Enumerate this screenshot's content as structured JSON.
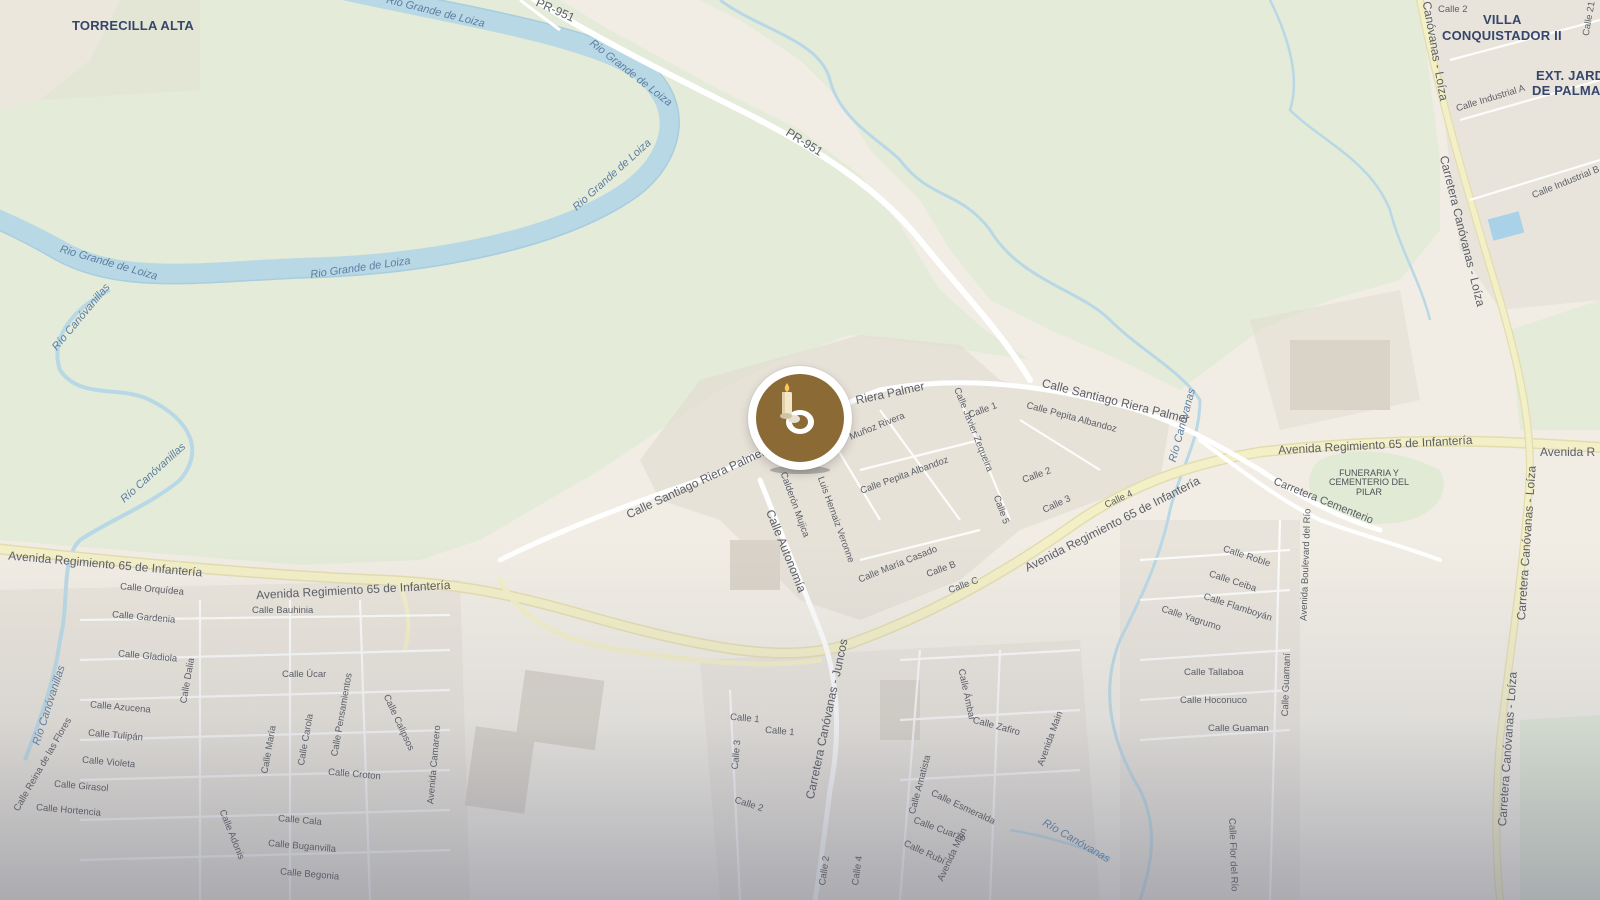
{
  "map": {
    "places": {
      "torrecilla_alta": "TORRECILLA ALTA",
      "villa_conquistador_1": "VILLA",
      "villa_conquistador_2": "CONQUISTADOR II",
      "ext_jard_1": "EXT. JARD",
      "ext_jard_2": "DE PALMA"
    },
    "rivers": {
      "rio_grande_1": "Rio Grande de Loiza",
      "rio_grande_2": "Rio Grande de Loiza",
      "rio_grande_3": "Rio Grande de Loiza",
      "rio_grande_4": "Rio Grande de Loiza",
      "rio_grande_5": "Rio Grande de Loiza",
      "rio_grande_6": "Rio Grande de Loiza",
      "rio_canovanillas_1": "Río Canóvanillas",
      "rio_canovanillas_2": "Río Canóvanillas",
      "rio_canovanillas_3": "Río Canóvanillas",
      "rio_canovanas_1": "Río Canóvanas",
      "rio_canovanas_2": "Río Canóvanas"
    },
    "roads": {
      "pr951_top": "PR-951",
      "pr951": "PR-951",
      "avenida_west": "Avenida Regimiento 65 de Infantería",
      "avenida_mid": "Avenida Regimiento 65 de Infantería",
      "avenida_diag": "Avenida Regimiento 65 de Infantería",
      "avenida_east": "Avenida Regimiento 65 de Infantería",
      "avenida_far_east": "Avenida R",
      "riera_palmer_1": "Calle Santiago Riera Palmer",
      "riera_palmer_2": "Calle Santiago Riera Palmer",
      "riera_palmer_3": "Riera Palmer",
      "calle_autonomia": "Calle Autonomía",
      "carretera_juncos": "Carretera Canóvanas - Juncos",
      "carretera_loiza_top": "Canóvanas - Loíza",
      "carretera_loiza_mid": "Carretera Canóvanas - Loíza",
      "carretera_loiza_east": "Carretera Canóvanas - Loíza",
      "carretera_loiza_bottom": "Carretera Canóvanas - Loíza",
      "carretera_cementerio": "Carretera Cementerio",
      "avenida_boulevard": "Avenida Boulevard del Río",
      "calle_camarero": "Avenida Camarero"
    },
    "streets": {
      "orquidea": "Calle Orquídea",
      "gardenia": "Calle Gardenia",
      "bauhinia": "Calle Bauhinia",
      "gladiola": "Calle Gladiola",
      "dalia": "Calle Dalia",
      "ucar": "Calle Úcar",
      "azucena": "Calle Azucena",
      "tulipan": "Calle Tulipán",
      "violeta": "Calle Violeta",
      "girasol": "Calle Girasol",
      "hortencia": "Calle Hortencia",
      "reina_flores": "Calle Reina de las Flores",
      "maria": "Calle María",
      "carola": "Calle Carola",
      "pensamientos": "Calle Pensamientos",
      "calipsos": "Calle Calipsos",
      "croton": "Calle Croton",
      "cala": "Calle Cala",
      "buganvilla": "Calle Buganvilla",
      "begonia": "Calle Begonia",
      "adonis": "Calle Adonis",
      "munoz_rivera": "Muñoz Rivera",
      "javier_zequeira": "Calle Javier Zequeira",
      "calle1_top": "Calle 1",
      "pepita_albandoz_1": "Calle Pepita Albandoz",
      "pepita_albandoz_2": "Calle Pepita Albandoz",
      "calle2": "Calle 2",
      "calle3": "Calle 3",
      "calle4": "Calle 4",
      "calle5": "Calle 5",
      "calderon": "Calderón Mujica",
      "hernaiz": "Luis Hernaiz Veronne",
      "maria_casado": "Calle María Casado",
      "calle_b": "Calle B",
      "calle_c": "Calle C",
      "calle1_a": "Calle 1",
      "calle1_b": "Calle 1",
      "calle3_s": "Calle 3",
      "calle2_s": "Calle 2",
      "calle2_bottom": "Calle 2",
      "calle4_bottom": "Calle 4",
      "ambar": "Calle Ámbar",
      "zafiro": "Calle Zafiro",
      "amatista": "Calle Amatista",
      "esmeralda": "Calle Esmeralda",
      "cuarzo": "Calle Cuarzo",
      "rubi": "Calle Rubí",
      "avenida_main_1": "Avenida Main",
      "avenida_main_2": "Avenida Main",
      "roble": "Calle Roble",
      "ceiba": "Calle Ceiba",
      "flamboyan": "Calle Flamboyán",
      "yagrumo": "Calle Yagrumo",
      "tallaboa": "Calle Tallaboa",
      "hoconuco": "Calle Hoconuco",
      "guaman": "Calle Guaman",
      "guamani": "Calle Guamaní",
      "flor_rio": "Calle Flor del Río",
      "industrial_a": "Calle Industrial A",
      "industrial_b": "Calle Industrial B",
      "calle2_ne": "Calle 2",
      "calle21_ne": "Calle 21"
    },
    "poi": {
      "funeraria": "FUNERARIA Y CEMENTERIO DEL PILAR"
    },
    "marker": {
      "icon": "candle-icon"
    },
    "colors": {
      "land": "#f1ede4",
      "park": "#e3ead7",
      "water": "#b4d5e6",
      "road_main": "#f2eec2",
      "road_minor": "#ffffff",
      "building": "#e2dcd1",
      "marker": "#8c6a35",
      "place_label": "#36466b"
    }
  }
}
